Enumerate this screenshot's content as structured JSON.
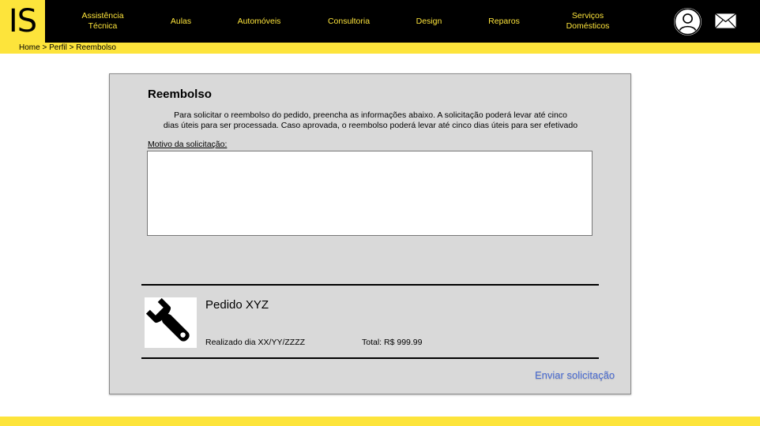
{
  "header": {
    "logo": "IS",
    "nav": [
      {
        "label": "Assistência\nTécnica"
      },
      {
        "label": "Aulas"
      },
      {
        "label": "Automóveis"
      },
      {
        "label": "Consultoria"
      },
      {
        "label": "Design"
      },
      {
        "label": "Reparos"
      },
      {
        "label": "Serviços\nDomésticos"
      }
    ],
    "profile_icon": "user-circle-icon",
    "mail_icon": "envelope-icon"
  },
  "breadcrumb": {
    "home": "Home",
    "sep1": " > ",
    "profile": "Perfil",
    "sep2": " > ",
    "current": "Reembolso"
  },
  "card": {
    "title": "Reembolso",
    "description_line1": "Para solicitar o reembolso do pedido, preencha as informações abaixo. A solicitação poderá levar até cinco",
    "description_line2": "dias úteis para ser processada. Caso aprovada, o reembolso poderá levar até cinco dias úteis para ser efetivado",
    "reason_label": "Motivo da solicitação:",
    "reason_value": "",
    "submit_label": "Enviar solicitação"
  },
  "order": {
    "icon": "wrench-icon",
    "name": "Pedido XYZ",
    "date": "Realizado dia XX/YY/ZZZZ",
    "total": "Total: R$ 999.99"
  },
  "colors": {
    "accent": "#fde43b",
    "header_bg": "#000000",
    "card_bg": "#d9d9d9",
    "link": "#4a6cd4"
  }
}
